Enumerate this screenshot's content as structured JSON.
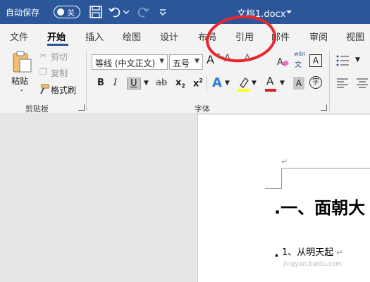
{
  "titlebar": {
    "autosave_label": "自动保存",
    "toggle_label": "关",
    "doc_title": "文档1.docx"
  },
  "tabs": [
    "文件",
    "开始",
    "插入",
    "绘图",
    "设计",
    "布局",
    "引用",
    "邮件",
    "审阅",
    "视图"
  ],
  "clipboard": {
    "paste": "粘贴",
    "cut": "剪切",
    "copy": "复制",
    "format_painter": "格式刷",
    "group": "剪贴板"
  },
  "font": {
    "font_name": "等线 (中文正文)",
    "font_size": "五号",
    "group": "字体",
    "phonetic_top": "wén",
    "phonetic_bottom": "文",
    "bold": "B",
    "italic": "I",
    "underline": "U",
    "strike": "ab",
    "subscript": "x",
    "superscript": "x",
    "sub_mark": "2",
    "sup_mark": "2",
    "grow_font": "A",
    "font_color_letter": "A",
    "enclose": "字"
  },
  "document": {
    "heading": ".一、面朝大",
    "list_item": "1、从明天起",
    "para_mark": "↵",
    "watermark": "jingyan.baidu.com"
  },
  "colors": {
    "title_bar": "#2b579a",
    "annotation": "#e8262c",
    "font_color": "#e02020",
    "highlight": "#ffff00"
  }
}
